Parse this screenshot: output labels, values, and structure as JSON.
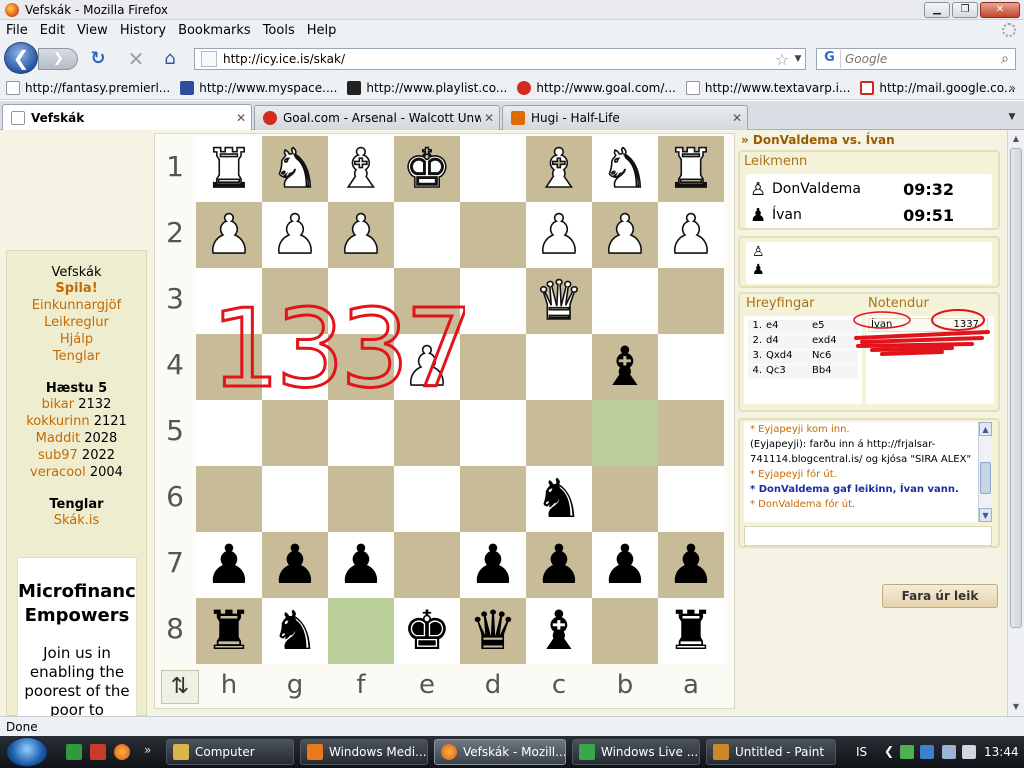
{
  "window": {
    "title": "Vefskák - Mozilla Firefox",
    "controls": {
      "minimize": "▁",
      "maximize": "❐",
      "close": "✕"
    }
  },
  "menu": {
    "items": [
      "File",
      "Edit",
      "View",
      "History",
      "Bookmarks",
      "Tools",
      "Help"
    ]
  },
  "nav": {
    "back": "❮",
    "forward": "❯",
    "reload": "↻",
    "stop": "✕",
    "home": "⌂",
    "url": "http://icy.ice.is/skak/",
    "bookmark_star": "☆",
    "url_dropdown": "▼",
    "search_engine": "G",
    "search_placeholder": "Google",
    "search_icon": "⌕"
  },
  "bookmarks": [
    {
      "label": "http://fantasy.premierl...",
      "icon": "generic"
    },
    {
      "label": "http://www.myspace....",
      "icon": "myspace"
    },
    {
      "label": "http://www.playlist.co...",
      "icon": "playlist"
    },
    {
      "label": "http://www.goal.com/...",
      "icon": "goal"
    },
    {
      "label": "http://www.textavarp.i...",
      "icon": "generic"
    },
    {
      "label": "http://mail.google.co...",
      "icon": "gmail"
    }
  ],
  "bookmarks_chevron": "»",
  "tabs": [
    {
      "label": "Vefskák",
      "icon": "page",
      "active": true
    },
    {
      "label": "Goal.com - Arsenal - Walcott Unwo...",
      "icon": "goal",
      "active": false
    },
    {
      "label": "Hugi - Half-Life",
      "icon": "hugi",
      "active": false
    }
  ],
  "tab_close": "✕",
  "tab_list": "▼",
  "sidebar": {
    "title": "Vefskák",
    "links": [
      {
        "label": "Spila!",
        "bold": true
      },
      {
        "label": "Einkunnargjöf",
        "bold": false
      },
      {
        "label": "Leikreglur",
        "bold": false
      },
      {
        "label": "Hjálp",
        "bold": false
      },
      {
        "label": "Tenglar",
        "bold": false
      }
    ],
    "top_title": "Hæstu 5",
    "top": [
      {
        "name": "bikar",
        "score": "2132"
      },
      {
        "name": "kokkurinn",
        "score": "2121"
      },
      {
        "name": "Maddit",
        "score": "2028"
      },
      {
        "name": "sub97",
        "score": "2022"
      },
      {
        "name": "veracool",
        "score": "2004"
      }
    ],
    "links_title": "Tenglar",
    "links2": [
      "Skák.is"
    ],
    "ad": {
      "headline": "Microfinance Empowers",
      "text": "Join us in enabling the poorest of the poor to improve"
    }
  },
  "board": {
    "ranks": [
      "1",
      "2",
      "3",
      "4",
      "5",
      "6",
      "7",
      "8"
    ],
    "files": [
      "h",
      "g",
      "f",
      "e",
      "d",
      "c",
      "b",
      "a"
    ],
    "flip_label": "⇅",
    "annotation": "1337",
    "highlighted": [
      "4-6",
      "7-2"
    ],
    "squares": [
      [
        "wR",
        "wN",
        "wB",
        "wK",
        "",
        "wB",
        "wN",
        "wR"
      ],
      [
        "wP",
        "wP",
        "wP",
        "",
        "",
        "wP",
        "wP",
        "wP"
      ],
      [
        "",
        "",
        "",
        "",
        "",
        "wQ",
        "",
        ""
      ],
      [
        "",
        "",
        "",
        "wP",
        "",
        "",
        "bB",
        ""
      ],
      [
        "",
        "",
        "",
        "",
        "",
        "",
        "",
        ""
      ],
      [
        "",
        "",
        "",
        "",
        "",
        "bN",
        "",
        ""
      ],
      [
        "bP",
        "bP",
        "bP",
        "",
        "bP",
        "bP",
        "bP",
        "bP"
      ],
      [
        "bR",
        "bN",
        "",
        "bK",
        "bQ",
        "bB",
        "",
        "bR"
      ]
    ]
  },
  "game": {
    "title": "» DonValdema vs. Ívan",
    "players_heading": "Leikmenn",
    "players": [
      {
        "name": "DonValdema",
        "time": "09:32",
        "pawn": "♙"
      },
      {
        "name": "Ívan",
        "time": "09:51",
        "pawn": "♟"
      }
    ],
    "captured": [
      "♙",
      "♟"
    ],
    "moves_heading": "Hreyfingar",
    "users_heading": "Notendur",
    "moves": [
      {
        "n": "1.",
        "w": "e4",
        "b": "e5"
      },
      {
        "n": "2.",
        "w": "d4",
        "b": "exd4"
      },
      {
        "n": "3.",
        "w": "Qxd4",
        "b": "Nc6"
      },
      {
        "n": "4.",
        "w": "Qc3",
        "b": "Bb4"
      }
    ],
    "users": [
      {
        "name": "Ívan",
        "rating": "1337"
      }
    ],
    "chat": [
      {
        "text": "* Eyjapeyji kom inn.",
        "type": "sys"
      },
      {
        "text": "(Eyjapeyji): farðu inn á http://frjalsar-741114.blogcentral.is/  og kjósa \"SIRA ALEX\"",
        "type": "msg"
      },
      {
        "text": "* Eyjapeyji fór út.",
        "type": "sys"
      },
      {
        "text": "* DonValdema gaf leikinn, Ívan vann.",
        "type": "res"
      },
      {
        "text": "* DonValdema fór út.",
        "type": "sys"
      }
    ],
    "chat_up": "▲",
    "chat_down": "▼",
    "leave_button": "Fara úr leik"
  },
  "page_scroll": {
    "up": "▲",
    "down": "▼"
  },
  "status": "Done",
  "taskbar": {
    "ql_chevron": "»",
    "tasks": [
      {
        "label": "Computer",
        "active": false,
        "icon_color": "#d9b64a"
      },
      {
        "label": "Windows Medi...",
        "active": false,
        "icon_color": "#e87a1a"
      },
      {
        "label": "Vefskák - Mozill...",
        "active": true,
        "icon_color": "#e2611b"
      },
      {
        "label": "Windows Live ...",
        "active": false,
        "icon_color": "#39a84a"
      },
      {
        "label": "Untitled - Paint",
        "active": false,
        "icon_color": "#c9882a"
      }
    ],
    "language": "IS",
    "tray_chevron": "❮",
    "clock": "13:44"
  },
  "colors": {
    "board_light": "#ffffff",
    "board_dark": "#c8bb98",
    "board_highlight": "#b9ce98",
    "link_orange": "#c46a00",
    "chat_result_blue": "#1a2ea6",
    "annotation_red": "#e0141a"
  }
}
